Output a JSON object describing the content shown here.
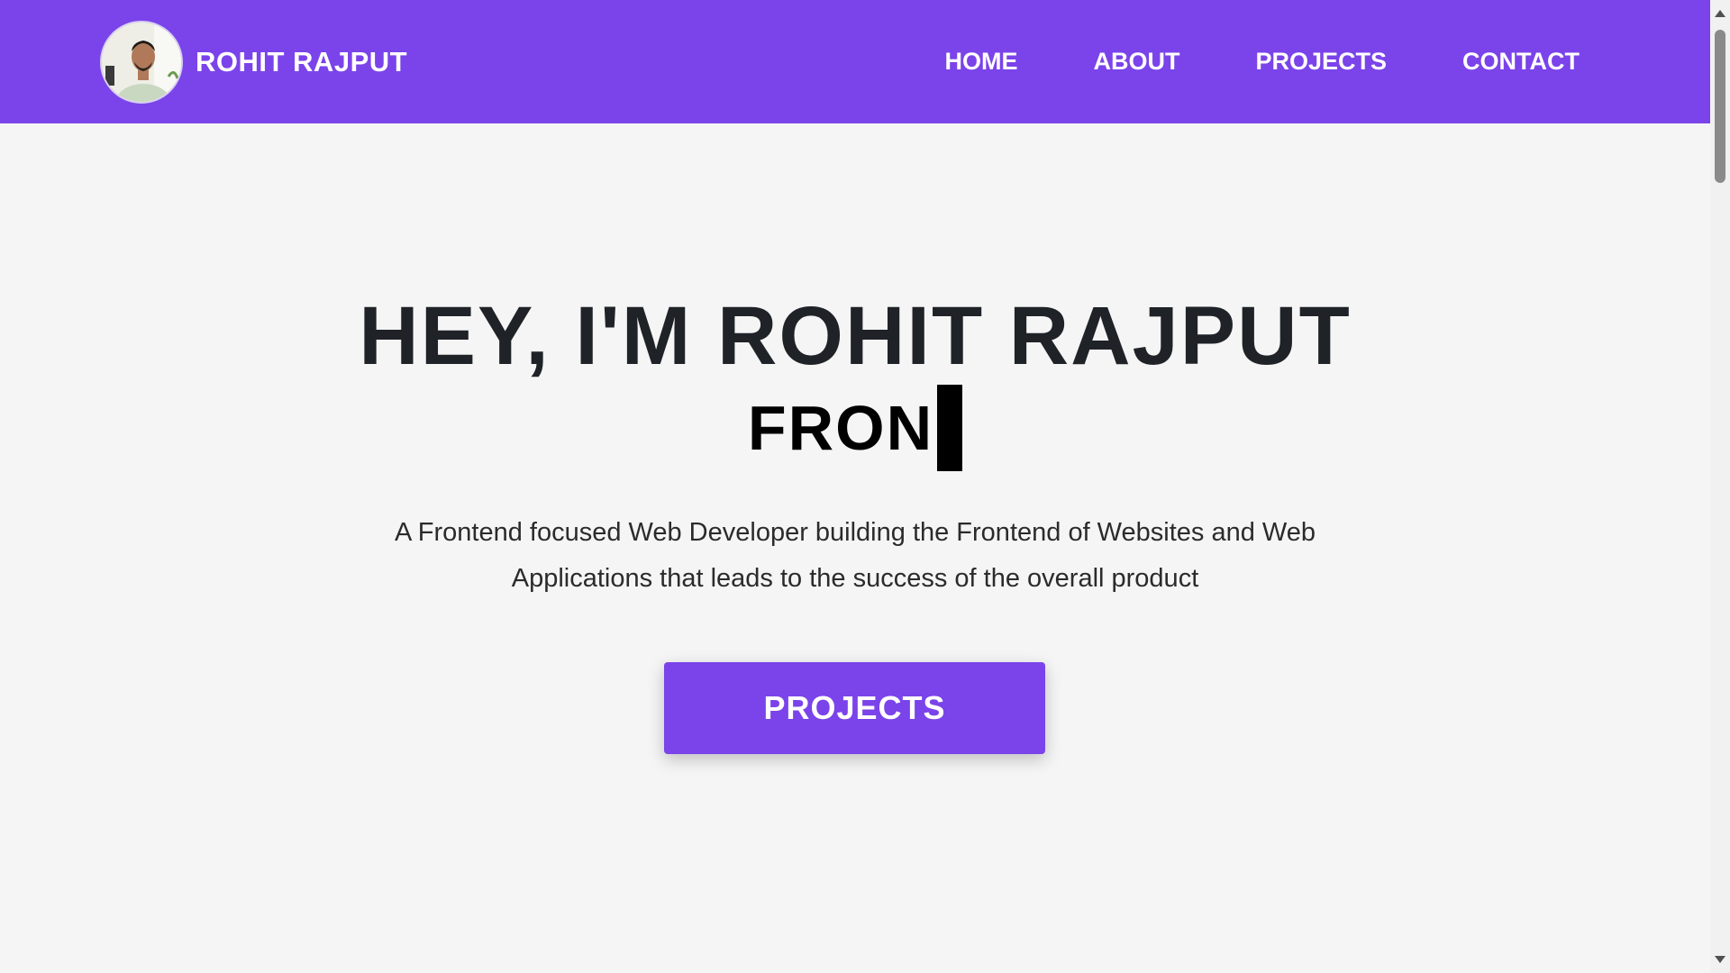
{
  "header": {
    "brand_name": "ROHIT RAJPUT",
    "avatar_icon": "profile-photo",
    "nav": [
      {
        "label": "HOME"
      },
      {
        "label": "ABOUT"
      },
      {
        "label": "PROJECTS"
      },
      {
        "label": "CONTACT"
      }
    ]
  },
  "hero": {
    "title": "HEY, I'M ROHIT RAJPUT",
    "typed_text": "FRON",
    "description": "A Frontend focused Web Developer building the Frontend of Websites and Web Applications that leads to the success of the overall product",
    "button_label": "PROJECTS"
  },
  "colors": {
    "brand_purple": "#7b43ea",
    "background": "#f5f5f5",
    "title_text": "#1f2328"
  }
}
